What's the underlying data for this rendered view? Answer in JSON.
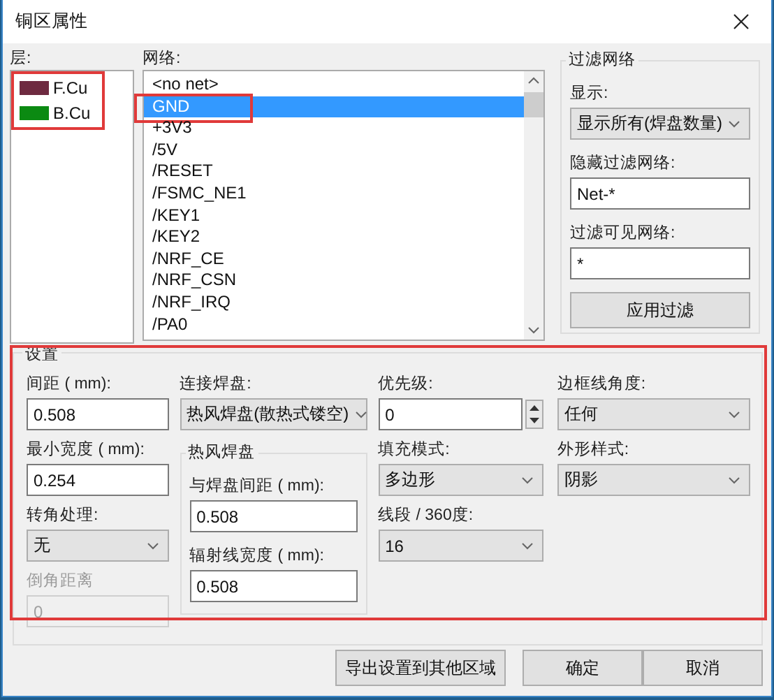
{
  "window": {
    "title": "铜区属性"
  },
  "layers": {
    "label": "层:",
    "highlighted": true,
    "items": [
      {
        "name": "F.Cu",
        "color": "#6e2a40"
      },
      {
        "name": "B.Cu",
        "color": "#0b8a12"
      }
    ]
  },
  "nets": {
    "label": "网络:",
    "items": [
      {
        "name": "<no net>",
        "selected": false,
        "highlighted": false
      },
      {
        "name": "GND",
        "selected": true,
        "highlighted": true
      },
      {
        "name": "+3V3",
        "selected": false,
        "highlighted": false
      },
      {
        "name": "/5V",
        "selected": false,
        "highlighted": false
      },
      {
        "name": "/RESET",
        "selected": false,
        "highlighted": false
      },
      {
        "name": "/FSMC_NE1",
        "selected": false,
        "highlighted": false
      },
      {
        "name": "/KEY1",
        "selected": false,
        "highlighted": false
      },
      {
        "name": "/KEY2",
        "selected": false,
        "highlighted": false
      },
      {
        "name": "/NRF_CE",
        "selected": false,
        "highlighted": false
      },
      {
        "name": "/NRF_CSN",
        "selected": false,
        "highlighted": false
      },
      {
        "name": "/NRF_IRQ",
        "selected": false,
        "highlighted": false
      },
      {
        "name": "/PA0",
        "selected": false,
        "highlighted": false
      }
    ]
  },
  "filter": {
    "title": "过滤网络",
    "fields": [
      {
        "kind": "select",
        "label": "显示:",
        "value": "显示所有(焊盘数量)",
        "disabled": false
      },
      {
        "kind": "input",
        "label": "隐藏过滤网络:",
        "value": "Net-*",
        "disabled": false
      },
      {
        "kind": "input",
        "label": "过滤可见网络:",
        "value": "*",
        "disabled": false
      }
    ],
    "apply_button": "应用过滤"
  },
  "settings": {
    "title": "设置",
    "highlighted": true,
    "columns": [
      [
        {
          "kind": "input",
          "label": "间距 ( mm):",
          "value": "0.508",
          "disabled": false
        },
        {
          "kind": "input",
          "label": "最小宽度 ( mm):",
          "value": "0.254",
          "disabled": false
        },
        {
          "kind": "select",
          "label": "转角处理:",
          "value": "无",
          "disabled": false
        },
        {
          "kind": "input",
          "label": "倒角距离",
          "value": "0",
          "disabled": true
        }
      ],
      [
        {
          "kind": "select",
          "label": "连接焊盘:",
          "value": "热风焊盘(散热式镂空)",
          "disabled": false
        },
        {
          "kind": "group",
          "title": "热风焊盘",
          "fields": [
            {
              "kind": "input",
              "label": "与焊盘间距 ( mm):",
              "value": "0.508",
              "disabled": false
            },
            {
              "kind": "input",
              "label": "辐射线宽度 ( mm):",
              "value": "0.508",
              "disabled": false
            }
          ]
        }
      ],
      [
        {
          "kind": "spin",
          "label": "优先级:",
          "value": "0",
          "disabled": false
        },
        {
          "kind": "select",
          "label": "填充模式:",
          "value": "多边形",
          "disabled": false
        },
        {
          "kind": "select",
          "label": "线段 / 360度:",
          "value": "16",
          "disabled": false
        }
      ],
      [
        {
          "kind": "select",
          "label": "边框线角度:",
          "value": "任何",
          "disabled": false
        },
        {
          "kind": "select",
          "label": "外形样式:",
          "value": "阴影",
          "disabled": false
        }
      ]
    ]
  },
  "buttons": [
    {
      "label": "导出设置到其他区域"
    },
    {
      "label": "确定"
    },
    {
      "label": "取消"
    }
  ]
}
